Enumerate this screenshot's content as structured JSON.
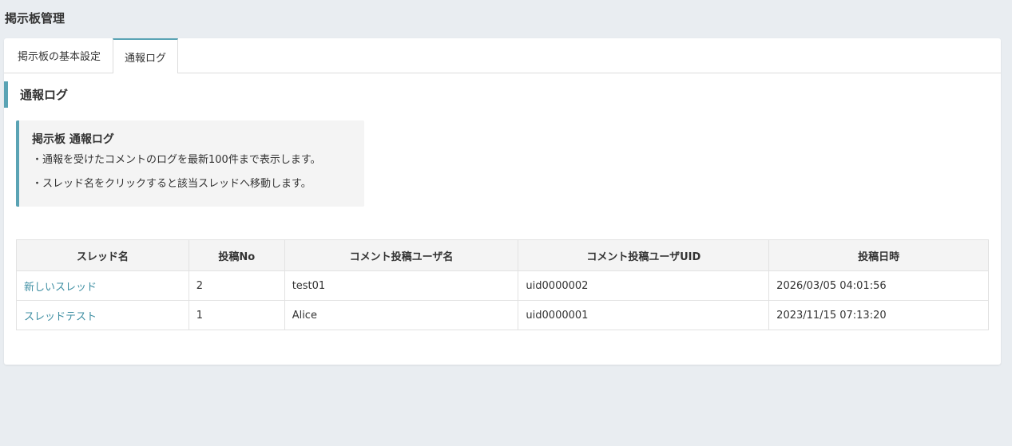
{
  "page": {
    "title": "掲示板管理"
  },
  "tabs": [
    {
      "label": "掲示板の基本設定",
      "active": false
    },
    {
      "label": "通報ログ",
      "active": true
    }
  ],
  "section": {
    "heading": "通報ログ"
  },
  "info": {
    "title": "掲示板 通報ログ",
    "lines": [
      "・通報を受けたコメントのログを最新100件まで表示します。",
      "・スレッド名をクリックすると該当スレッドへ移動します。"
    ]
  },
  "table": {
    "headers": [
      "スレッド名",
      "投稿No",
      "コメント投稿ユーザ名",
      "コメント投稿ユーザUID",
      "投稿日時"
    ],
    "rows": [
      {
        "thread": "新しいスレッド",
        "post_no": "2",
        "user": "test01",
        "uid": "uid0000002",
        "datetime": "2026/03/05 04:01:56"
      },
      {
        "thread": "スレッドテスト",
        "post_no": "1",
        "user": "Alice",
        "uid": "uid0000001",
        "datetime": "2023/11/15 07:13:20"
      }
    ]
  },
  "colors": {
    "accent": "#5aa3b4",
    "link": "#3f8fa3",
    "background": "#e9edf1"
  }
}
